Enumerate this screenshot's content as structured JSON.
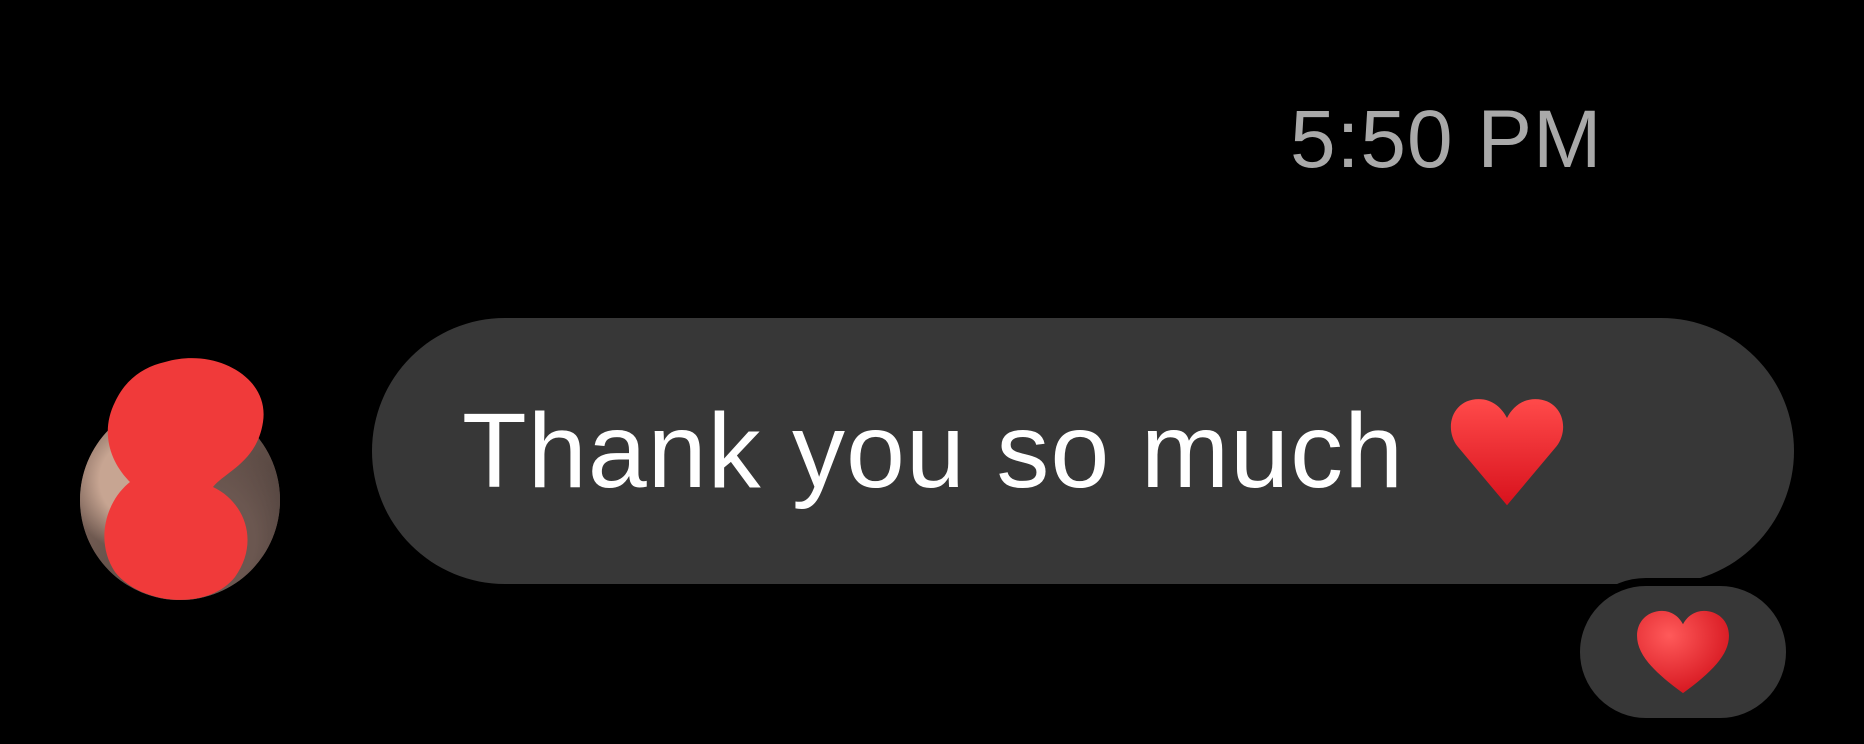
{
  "message": {
    "timestamp": "5:50 PM",
    "text": "Thank you so much",
    "inline_emoji": "heart-icon",
    "reaction": "heart-icon"
  },
  "colors": {
    "background": "#000000",
    "bubble": "#373737",
    "timestamp": "#a9a9a9",
    "text": "#ffffff",
    "heart": "#e8222b",
    "redaction": "#f03a3a"
  }
}
